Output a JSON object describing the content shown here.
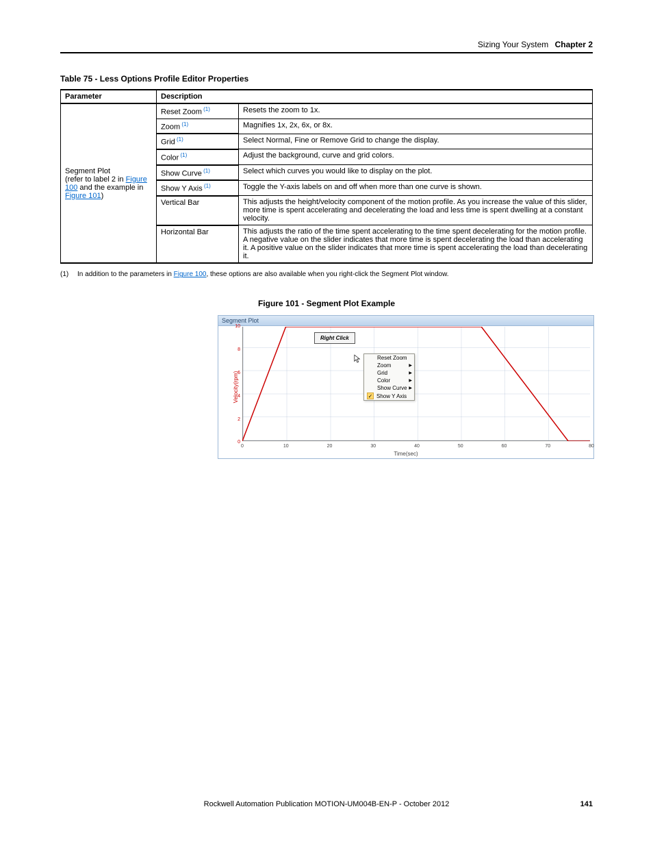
{
  "header": {
    "section": "Sizing Your System",
    "chapter": "Chapter 2"
  },
  "table": {
    "title": "Table 75 - Less Options Profile Editor Properties",
    "head": {
      "param": "Parameter",
      "desc": "Description"
    },
    "rowgroup_label_pre": "Segment Plot\n(refer to label 2 in ",
    "rowgroup_link1": "Figure 100",
    "rowgroup_label_mid": " and the example in ",
    "rowgroup_link2": "Figure 101",
    "rowgroup_label_post": ")",
    "rows": [
      {
        "name": "Reset Zoom",
        "sup": "(1)",
        "desc": "Resets the zoom to 1x."
      },
      {
        "name": "Zoom",
        "sup": "(1)",
        "desc": "Magnifies 1x, 2x, 6x, or 8x."
      },
      {
        "name": "Grid",
        "sup": "(1)",
        "desc": "Select Normal, Fine or Remove Grid to change the display."
      },
      {
        "name": "Color",
        "sup": "(1)",
        "desc": "Adjust the background, curve and grid colors."
      },
      {
        "name": "Show Curve",
        "sup": "(1)",
        "desc": "Select which curves you would like to display on the plot."
      },
      {
        "name": "Show Y Axis",
        "sup": "(1)",
        "desc": "Toggle the Y-axis labels on and off when more than one curve is shown."
      },
      {
        "name": "Vertical Bar",
        "sup": "",
        "desc": "This adjusts the height/velocity component of the motion profile. As you increase the value of this slider, more time is spent accelerating and decelerating the load and less time is spent dwelling at a constant velocity."
      },
      {
        "name": "Horizontal Bar",
        "sup": "",
        "desc": "This adjusts the ratio of the time spent accelerating to the time spent decelerating for the motion profile. A negative value on the slider indicates that more time is spent decelerating the load than accelerating it. A positive value on the slider indicates that more time is spent accelerating the load than decelerating it."
      }
    ]
  },
  "footnote": {
    "num": "(1)",
    "pre": "In addition to the parameters in ",
    "link": "Figure 100",
    "post": ", these options are also available when you right-click the Segment Plot window."
  },
  "figure": {
    "title": "Figure 101 - Segment Plot Example",
    "panel_title": "Segment Plot",
    "right_click": "Right Click",
    "ylabel": "Velocity(rpm)",
    "xlabel": "Time(sec)",
    "menu": [
      "Reset Zoom",
      "Zoom",
      "Grid",
      "Color",
      "Show Curve",
      "Show Y Axis"
    ],
    "menu_arrows": [
      false,
      true,
      true,
      true,
      true,
      false
    ],
    "menu_checked_idx": 5
  },
  "chart_data": {
    "type": "line",
    "title": "Segment Plot",
    "xlabel": "Time(sec)",
    "ylabel": "Velocity(rpm)",
    "xlim": [
      0,
      80
    ],
    "ylim": [
      0,
      10
    ],
    "xticks": [
      0,
      10,
      20,
      30,
      40,
      50,
      60,
      70,
      80
    ],
    "yticks": [
      0,
      2,
      4,
      6,
      8,
      10
    ],
    "series": [
      {
        "name": "Velocity",
        "color": "#cc0000",
        "x": [
          0,
          10,
          55,
          75,
          80
        ],
        "y": [
          0,
          10,
          10,
          0,
          0
        ]
      }
    ]
  },
  "footer": {
    "pub": "Rockwell Automation Publication MOTION-UM004B-EN-P - October 2012",
    "page": "141"
  }
}
